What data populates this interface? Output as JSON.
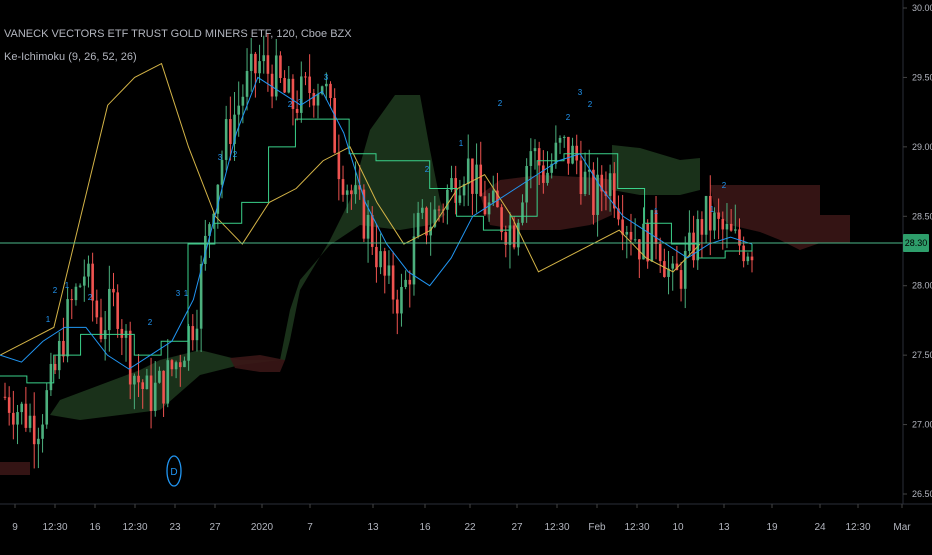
{
  "title": "VANECK VECTORS ETF TRUST GOLD MINERS ETF, 120, Cboe BZX",
  "indicator": "Ke-Ichimoku (9, 26, 52, 26)",
  "colors": {
    "background": "#000000",
    "up": "#26a69a",
    "up_candle": "#4caf7d",
    "down_candle": "#ef5350",
    "tenkan": "#2196f3",
    "kijun": "#3ad18a",
    "chikou": "#d4b447",
    "kumo_bull": "#1e3a1e",
    "kumo_bear": "#3a1616",
    "last_price_line": "#4db88a",
    "axis_text": "#b2b5be",
    "grid": "#1a1d26",
    "signal_marker": "#2196f3"
  },
  "axis": {
    "y_ticks": [
      "30.00",
      "29.50",
      "29.00",
      "28.50",
      "28.00",
      "27.50",
      "27.00",
      "26.50"
    ],
    "x_ticks": [
      "9",
      "12:30",
      "16",
      "12:30",
      "23",
      "27",
      "2020",
      "7",
      "13",
      "16",
      "22",
      "27",
      "12:30",
      "Feb",
      "12:30",
      "10",
      "13",
      "19",
      "24",
      "12:30",
      "Mar"
    ],
    "last_price": "28.30",
    "signal_label": "D"
  },
  "chart_data": {
    "type": "candlestick",
    "title": "VANECK VECTORS ETF TRUST GOLD MINERS ETF, 120, Cboe BZX",
    "ylim": [
      26.5,
      30.0
    ],
    "last_price": 28.3,
    "x_labels": [
      "9",
      "12:30",
      "16",
      "12:30",
      "23",
      "27",
      "2020",
      "7",
      "13",
      "16",
      "22",
      "27",
      "12:30",
      "Feb",
      "12:30",
      "10",
      "13",
      "19",
      "24",
      "12:30",
      "Mar"
    ],
    "series": [
      {
        "name": "Price",
        "close_path": [
          27.2,
          27.1,
          27.0,
          27.3,
          27.8,
          28.1,
          27.7,
          27.9,
          27.4,
          27.2,
          27.3,
          27.5,
          27.8,
          28.6,
          29.1,
          29.4,
          29.6,
          29.5,
          29.3,
          29.4,
          29.5,
          28.9,
          28.6,
          28.4,
          28.0,
          27.9,
          28.4,
          28.5,
          28.7,
          28.9,
          28.6,
          28.5,
          28.4,
          29.0,
          28.8,
          29.0,
          28.9,
          28.6,
          28.8,
          28.5,
          28.3,
          28.4,
          28.0,
          28.2,
          28.5,
          28.4,
          28.3,
          28.3
        ]
      },
      {
        "name": "Tenkan",
        "values": [
          27.5,
          27.45,
          27.6,
          27.7,
          27.7,
          27.5,
          27.4,
          27.5,
          27.6,
          27.9,
          28.5,
          29.1,
          29.5,
          29.4,
          29.3,
          29.4,
          29.1,
          28.6,
          28.3,
          28.1,
          28.0,
          28.2,
          28.5,
          28.6,
          28.7,
          28.8,
          28.9,
          28.95,
          28.7,
          28.5,
          28.4,
          28.3,
          28.2,
          28.3,
          28.35,
          28.3
        ]
      },
      {
        "name": "Kijun",
        "values": [
          27.35,
          27.3,
          27.5,
          27.65,
          27.65,
          27.5,
          27.6,
          28.3,
          28.45,
          28.6,
          29.0,
          29.2,
          29.2,
          28.95,
          28.9,
          28.9,
          28.7,
          28.5,
          28.4,
          28.5,
          28.9,
          28.95,
          28.95,
          28.7,
          28.45,
          28.3,
          28.2,
          28.25,
          28.3
        ]
      },
      {
        "name": "Chikou",
        "values": [
          27.5,
          27.6,
          27.7,
          28.5,
          29.3,
          29.5,
          29.6,
          29.0,
          28.5,
          28.3,
          28.6,
          28.7,
          28.9,
          29.0,
          28.6,
          28.3,
          28.4,
          28.7,
          28.8,
          28.5,
          28.1,
          28.2,
          28.3,
          28.4,
          28.2,
          28.1,
          28.3
        ]
      }
    ],
    "kumo": {
      "bull_regions": 4,
      "bear_regions": 3
    }
  }
}
